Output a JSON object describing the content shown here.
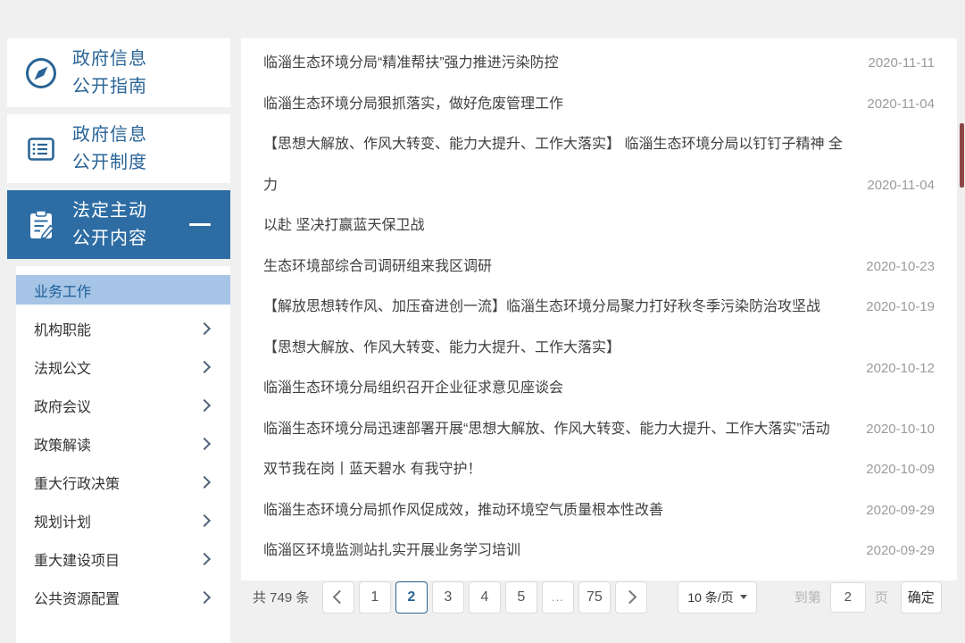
{
  "sidebar": {
    "sections": [
      {
        "line1": "政府信息",
        "line2": "公开指南",
        "icon": "compass-icon",
        "active": false
      },
      {
        "line1": "政府信息",
        "line2": "公开制度",
        "icon": "ledger-icon",
        "active": false
      },
      {
        "line1": "法定主动",
        "line2": "公开内容",
        "icon": "clipboard-pencil-icon",
        "active": true,
        "collapse_indicator": "minus-icon"
      }
    ],
    "submenu": [
      {
        "label": "业务工作",
        "active": true,
        "chevron": false
      },
      {
        "label": "机构职能",
        "chevron": true
      },
      {
        "label": "法规公文",
        "chevron": true
      },
      {
        "label": "政府会议",
        "chevron": true
      },
      {
        "label": "政策解读",
        "chevron": true
      },
      {
        "label": "重大行政决策",
        "chevron": true
      },
      {
        "label": "规划计划",
        "chevron": true
      },
      {
        "label": "重大建设项目",
        "chevron": true
      },
      {
        "label": "公共资源配置",
        "chevron": true
      }
    ]
  },
  "news": [
    {
      "title": "临淄生态环境分局“精准帮扶”强力推进污染防控",
      "date": "2020-11-11"
    },
    {
      "title": "临淄生态环境分局狠抓落实，做好危废管理工作",
      "date": "2020-11-04"
    },
    {
      "title": "【思想大解放、作风大转变、能力大提升、工作大落实】 临淄生态环境分局以钉钉子精神 全力\n以赴 坚决打赢蓝天保卫战",
      "date": "2020-11-04"
    },
    {
      "title": "生态环境部综合司调研组来我区调研",
      "date": "2020-10-23"
    },
    {
      "title": "【解放思想转作风、加压奋进创一流】临淄生态环境分局聚力打好秋冬季污染防治攻坚战",
      "date": "2020-10-19"
    },
    {
      "title": "【思想大解放、作风大转变、能力大提升、工作大落实】\n临淄生态环境分局组织召开企业征求意见座谈会",
      "date": "2020-10-12"
    },
    {
      "title": "临淄生态环境分局迅速部署开展“思想大解放、作风大转变、能力大提升、工作大落实”活动",
      "date": "2020-10-10"
    },
    {
      "title": "双节我在岗丨蓝天碧水 有我守护！",
      "date": "2020-10-09"
    },
    {
      "title": "临淄生态环境分局抓作风促成效，推动环境空气质量根本性改善",
      "date": "2020-09-29"
    },
    {
      "title": "临淄区环境监测站扎实开展业务学习培训",
      "date": "2020-09-29"
    }
  ],
  "pagination": {
    "total_label": "共 749 条",
    "pages": [
      {
        "label": "1"
      },
      {
        "label": "2",
        "active": true
      },
      {
        "label": "3"
      },
      {
        "label": "4"
      },
      {
        "label": "5"
      },
      {
        "label": "...",
        "type": "dots"
      },
      {
        "label": "75"
      }
    ],
    "page_size_label": "10 条/页",
    "goto_prefix": "到第",
    "goto_value": "2",
    "goto_suffix": "页",
    "confirm_label": "确定"
  },
  "icons": {
    "compass-icon": "compass",
    "ledger-icon": "document-with-lines",
    "clipboard-pencil-icon": "clipboard-with-pencil",
    "minus-icon": "collapse-minus",
    "chevron-right-icon": "expand-arrow",
    "prev-page-icon": "chevron-left",
    "next-page-icon": "chevron-right",
    "caret-down-icon": "dropdown-caret"
  },
  "colors": {
    "page_bg": "#f0f0f0",
    "panel_bg": "#ffffff",
    "accent_blue": "#2a6496",
    "active_section_bg": "#2e6da4",
    "submenu_active_bg": "#a6c4e5",
    "submenu_active_text": "#1c5e99",
    "title_text": "#404040",
    "date_text": "#9b9b9b",
    "pager_border": "#dcdcdc",
    "scrollbar_thumb": "#8e4646"
  }
}
